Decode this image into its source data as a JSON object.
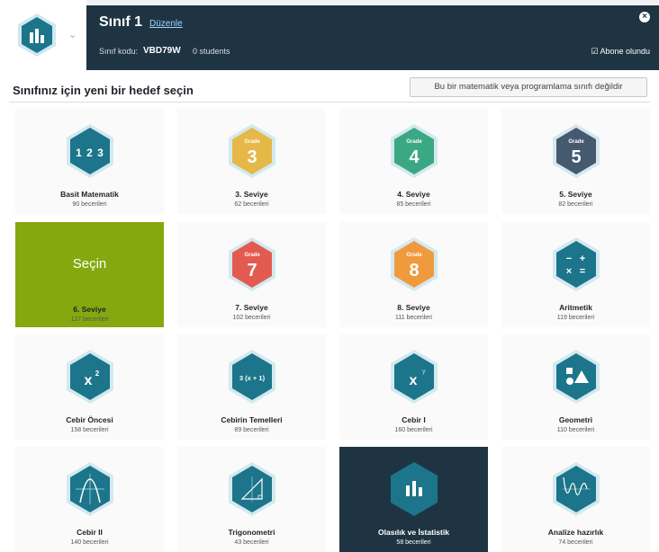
{
  "header": {
    "class_title": "Sınıf 1",
    "edit_label": "Düzenle",
    "class_code_label": "Sınıf kodu:",
    "class_code": "VBD79W",
    "students": "0 students",
    "subscribed_label": "Abone olundu"
  },
  "section": {
    "heading": "Sınıfınız için yeni bir hedef seçin",
    "not_math_button": "Bu bir matematik veya programlama sınıfı değildir"
  },
  "select_label": "Seçin",
  "courses": [
    {
      "name": "Basit Matematik",
      "skills": "90 becerileri",
      "icon": "123-icon",
      "color": "#1c758a"
    },
    {
      "name": "3. Seviye",
      "skills": "62 becerileri",
      "icon": "grade-3-icon",
      "color": "#e5b848",
      "grade": "3"
    },
    {
      "name": "4. Seviye",
      "skills": "85 becerileri",
      "icon": "grade-4-icon",
      "color": "#3aa882",
      "grade": "4"
    },
    {
      "name": "5. Seviye",
      "skills": "82 becerileri",
      "icon": "grade-5-icon",
      "color": "#455a6f",
      "grade": "5"
    },
    {
      "name": "6. Seviye",
      "skills": "127 becerileri",
      "icon": "grade-6-icon",
      "color": "#85a80f"
    },
    {
      "name": "7. Seviye",
      "skills": "102 becerileri",
      "icon": "grade-7-icon",
      "color": "#e35b50",
      "grade": "7"
    },
    {
      "name": "8. Seviye",
      "skills": "111 becerileri",
      "icon": "grade-8-icon",
      "color": "#f09a3e",
      "grade": "8"
    },
    {
      "name": "Aritmetik",
      "skills": "119 becerileri",
      "icon": "arithmetic-icon",
      "color": "#1c758a"
    },
    {
      "name": "Cebir Öncesi",
      "skills": "158 becerileri",
      "icon": "x-squared-icon",
      "color": "#1c758a"
    },
    {
      "name": "Cebirin Temelleri",
      "skills": "89 becerileri",
      "icon": "3x-plus-1-icon",
      "color": "#1c758a"
    },
    {
      "name": "Cebir I",
      "skills": "160 becerileri",
      "icon": "x-y-icon",
      "color": "#1c758a"
    },
    {
      "name": "Geometri",
      "skills": "110 becerileri",
      "icon": "shapes-icon",
      "color": "#1c758a"
    },
    {
      "name": "Cebir II",
      "skills": "140 becerileri",
      "icon": "parabola-icon",
      "color": "#1c758a"
    },
    {
      "name": "Trigonometri",
      "skills": "43 becerileri",
      "icon": "triangle-icon",
      "color": "#1c758a"
    },
    {
      "name": "Olasılık ve İstatistik",
      "skills": "58 becerileri",
      "icon": "bar-chart-icon",
      "color": "#1c758a"
    },
    {
      "name": "Analize hazırlık",
      "skills": "74 becerileri",
      "icon": "damped-wave-icon",
      "color": "#1c758a"
    }
  ],
  "colors": {
    "header_dark": "#1f3443",
    "accent_teal": "#1c758a",
    "selected_green": "#85a80f"
  }
}
